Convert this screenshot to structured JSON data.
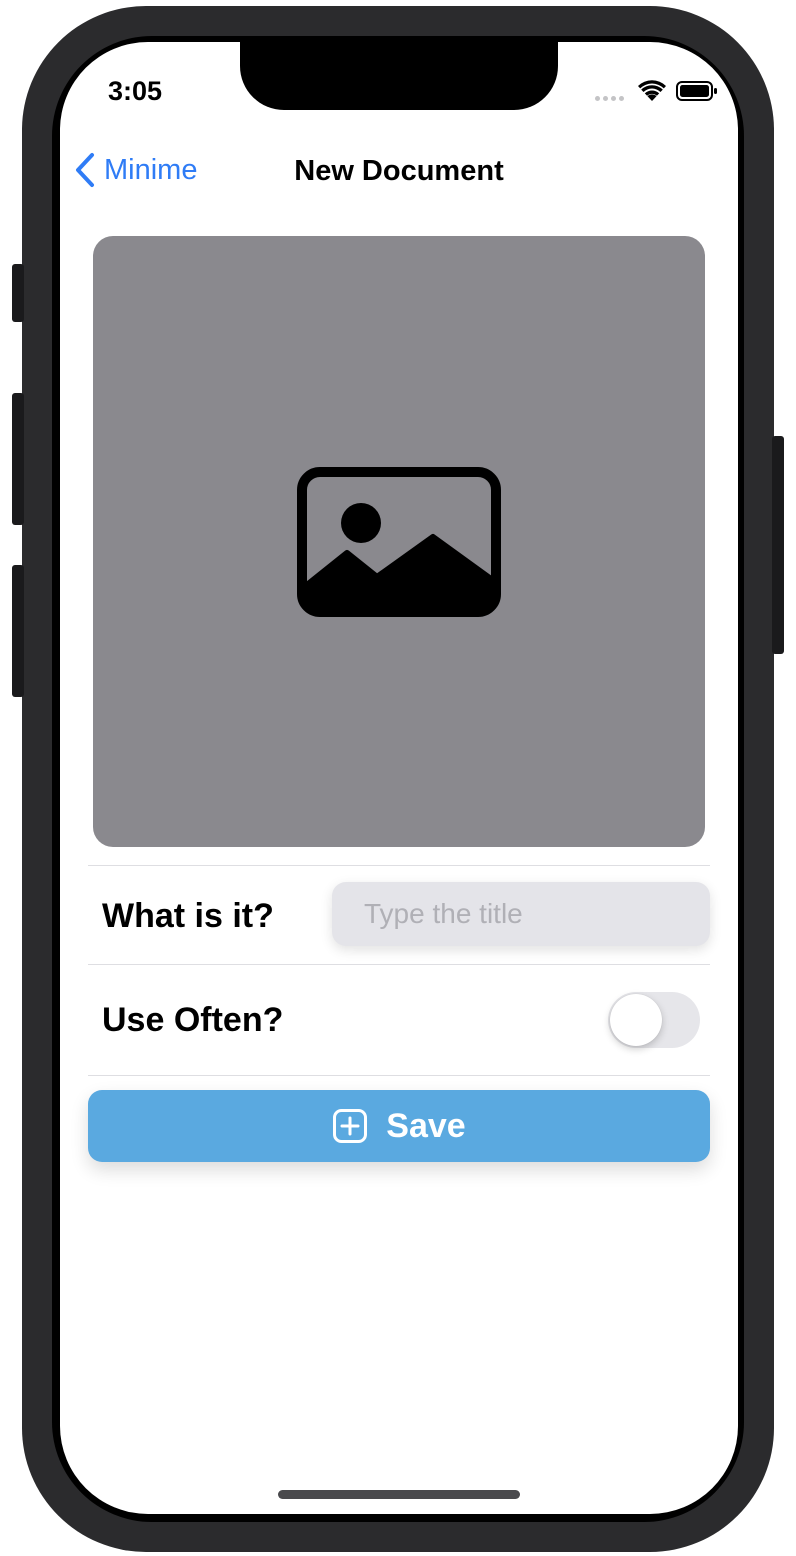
{
  "status_bar": {
    "time": "3:05",
    "icons": [
      "cellular-dots-icon",
      "wifi-icon",
      "battery-icon"
    ]
  },
  "nav": {
    "back_label": "Minime",
    "back_icon": "chevron-left-icon",
    "title": "New Document"
  },
  "image_placeholder": {
    "icon": "photo-icon",
    "background_color": "#8a898e"
  },
  "form": {
    "title_label": "What is it?",
    "title_input": {
      "value": "",
      "placeholder": "Type the title"
    },
    "use_often_label": "Use Often?",
    "use_often_toggle": {
      "on": false
    }
  },
  "save_button": {
    "label": "Save",
    "icon": "plus-square-icon",
    "color": "#5aa9e0"
  },
  "colors": {
    "accent": "#2f7cf6",
    "toggle_off": "#e6e6ea",
    "input_bg": "#e4e4e9"
  }
}
